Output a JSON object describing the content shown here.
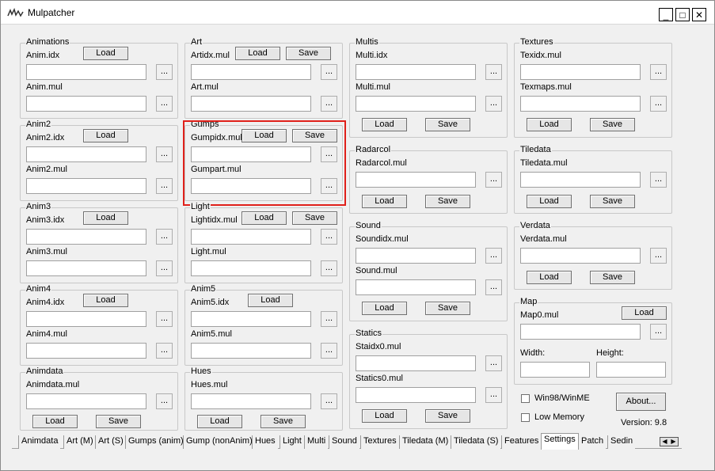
{
  "window": {
    "title": "Mulpatcher",
    "minimize": "_",
    "maximize": "□",
    "close": "✕"
  },
  "common": {
    "load": "Load",
    "save": "Save",
    "browse": "..."
  },
  "groups": {
    "animations": {
      "title": "Animations",
      "file1": "Anim.idx",
      "file2": "Anim.mul"
    },
    "anim2": {
      "title": "Anim2",
      "file1": "Anim2.idx",
      "file2": "Anim2.mul"
    },
    "anim3": {
      "title": "Anim3",
      "file1": "Anim3.idx",
      "file2": "Anim3.mul"
    },
    "anim4": {
      "title": "Anim4",
      "file1": "Anim4.idx",
      "file2": "Anim4.mul"
    },
    "animdata": {
      "title": "Animdata",
      "file1": "Animdata.mul"
    },
    "art": {
      "title": "Art",
      "file1": "Artidx.mul",
      "file2": "Art.mul"
    },
    "gumps": {
      "title": "Gumps",
      "file1": "Gumpidx.mul",
      "file2": "Gumpart.mul"
    },
    "light": {
      "title": "Light",
      "file1": "Lightidx.mul",
      "file2": "Light.mul"
    },
    "anim5": {
      "title": "Anim5",
      "file1": "Anim5.idx",
      "file2": "Anim5.mul"
    },
    "hues": {
      "title": "Hues",
      "file1": "Hues.mul"
    },
    "multis": {
      "title": "Multis",
      "file1": "Multi.idx",
      "file2": "Multi.mul"
    },
    "radarcol": {
      "title": "Radarcol",
      "file1": "Radarcol.mul"
    },
    "sound": {
      "title": "Sound",
      "file1": "Soundidx.mul",
      "file2": "Sound.mul"
    },
    "statics": {
      "title": "Statics",
      "file1": "Staidx0.mul",
      "file2": "Statics0.mul"
    },
    "textures": {
      "title": "Textures",
      "file1": "Texidx.mul",
      "file2": "Texmaps.mul"
    },
    "tiledata": {
      "title": "Tiledata",
      "file1": "Tiledata.mul"
    },
    "verdata": {
      "title": "Verdata",
      "file1": "Verdata.mul"
    },
    "map": {
      "title": "Map",
      "file1": "Map0.mul",
      "width_label": "Width:",
      "height_label": "Height:"
    }
  },
  "options": {
    "win98": "Win98/WinME",
    "low_memory": "Low Memory",
    "about": "About...",
    "version": "Version: 9.8"
  },
  "tabs": [
    "Animdata",
    "Art (M)",
    "Art (S)",
    "Gumps (anim)",
    "Gump (nonAnim)",
    "Hues",
    "Light",
    "Multi",
    "Sound",
    "Textures",
    "Tiledata (M)",
    "Tiledata (S)",
    "Features",
    "Settings",
    "Patch",
    "Sedin"
  ],
  "active_tab": "Settings",
  "highlight_color": "#e0201a"
}
